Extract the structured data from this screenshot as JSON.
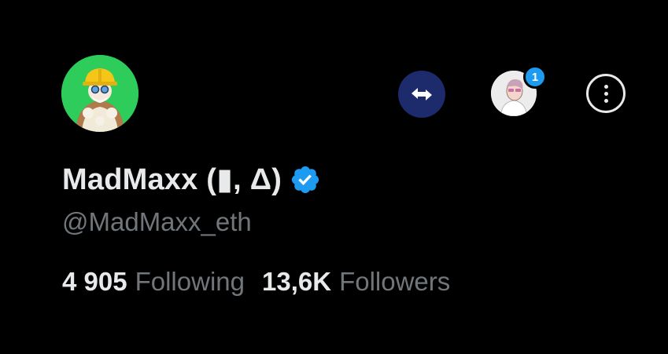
{
  "profile": {
    "display_name": "MadMaxx (▮, Δ)",
    "handle": "@MadMaxx_eth",
    "verified": true,
    "avatar_icon": "cartoon-character-with-hard-hat-avatar"
  },
  "header": {
    "swap_icon": "swap-arrows-icon",
    "account_avatar_icon": "user-avatar-icon",
    "notification_count": "1",
    "more_icon": "more-options-icon"
  },
  "stats": {
    "following_count": "4 905",
    "following_label": "Following",
    "followers_count": "13,6K",
    "followers_label": "Followers"
  },
  "colors": {
    "background": "#000000",
    "primary_text": "#e7e9ea",
    "secondary_text": "#71767b",
    "accent_blue": "#1d9bf0",
    "swap_button_bg": "#1d2a6b",
    "avatar_bg": "#2ecc5a"
  }
}
